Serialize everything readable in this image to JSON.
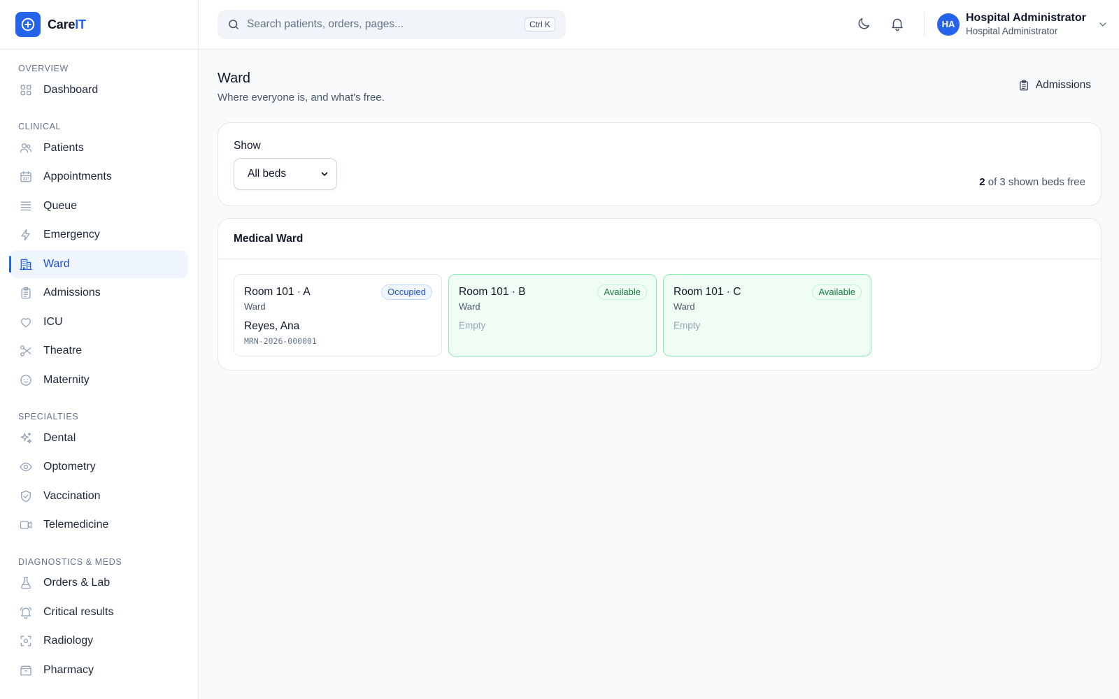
{
  "brand": {
    "name_main": "Care",
    "name_accent": "IT"
  },
  "search": {
    "placeholder": "Search patients, orders, pages...",
    "shortcut": "Ctrl K"
  },
  "user": {
    "initials": "HA",
    "name": "Hospital Administrator",
    "role": "Hospital Administrator"
  },
  "sidebar": {
    "sections": [
      {
        "label": "OVERVIEW",
        "items": [
          {
            "label": "Dashboard",
            "icon": "grid-icon"
          }
        ]
      },
      {
        "label": "CLINICAL",
        "items": [
          {
            "label": "Patients",
            "icon": "users-icon"
          },
          {
            "label": "Appointments",
            "icon": "calendar-icon"
          },
          {
            "label": "Queue",
            "icon": "list-icon"
          },
          {
            "label": "Emergency",
            "icon": "bolt-icon"
          },
          {
            "label": "Ward",
            "icon": "building-icon",
            "active": true
          },
          {
            "label": "Admissions",
            "icon": "clipboard-icon"
          },
          {
            "label": "ICU",
            "icon": "heart-icon"
          },
          {
            "label": "Theatre",
            "icon": "scissors-icon"
          },
          {
            "label": "Maternity",
            "icon": "baby-icon"
          }
        ]
      },
      {
        "label": "SPECIALTIES",
        "items": [
          {
            "label": "Dental",
            "icon": "sparkles-icon"
          },
          {
            "label": "Optometry",
            "icon": "eye-icon"
          },
          {
            "label": "Vaccination",
            "icon": "shield-check-icon"
          },
          {
            "label": "Telemedicine",
            "icon": "video-icon"
          }
        ]
      },
      {
        "label": "DIAGNOSTICS & MEDS",
        "items": [
          {
            "label": "Orders & Lab",
            "icon": "flask-icon"
          },
          {
            "label": "Critical results",
            "icon": "bell-alert-icon"
          },
          {
            "label": "Radiology",
            "icon": "scan-icon"
          },
          {
            "label": "Pharmacy",
            "icon": "pill-box-icon"
          }
        ]
      }
    ]
  },
  "page": {
    "title": "Ward",
    "subtitle": "Where everyone is, and what's free.",
    "admissions_link": "Admissions"
  },
  "filter": {
    "label": "Show",
    "selected": "All beds",
    "free_count": "2",
    "free_text": " of 3 shown beds free"
  },
  "ward": {
    "name": "Medical Ward",
    "beds": [
      {
        "name": "Room 101 · A",
        "type": "Ward",
        "status": "Occupied",
        "patient": "Reyes, Ana",
        "mrn": "MRN-2026-000001"
      },
      {
        "name": "Room 101 · B",
        "type": "Ward",
        "status": "Available",
        "empty_text": "Empty"
      },
      {
        "name": "Room 101 · C",
        "type": "Ward",
        "status": "Available",
        "empty_text": "Empty"
      }
    ]
  },
  "colors": {
    "accent": "#2563eb",
    "available_border": "#86efac",
    "available_bg": "#f0fdf4",
    "occupied_badge": "#1d4ed8"
  }
}
